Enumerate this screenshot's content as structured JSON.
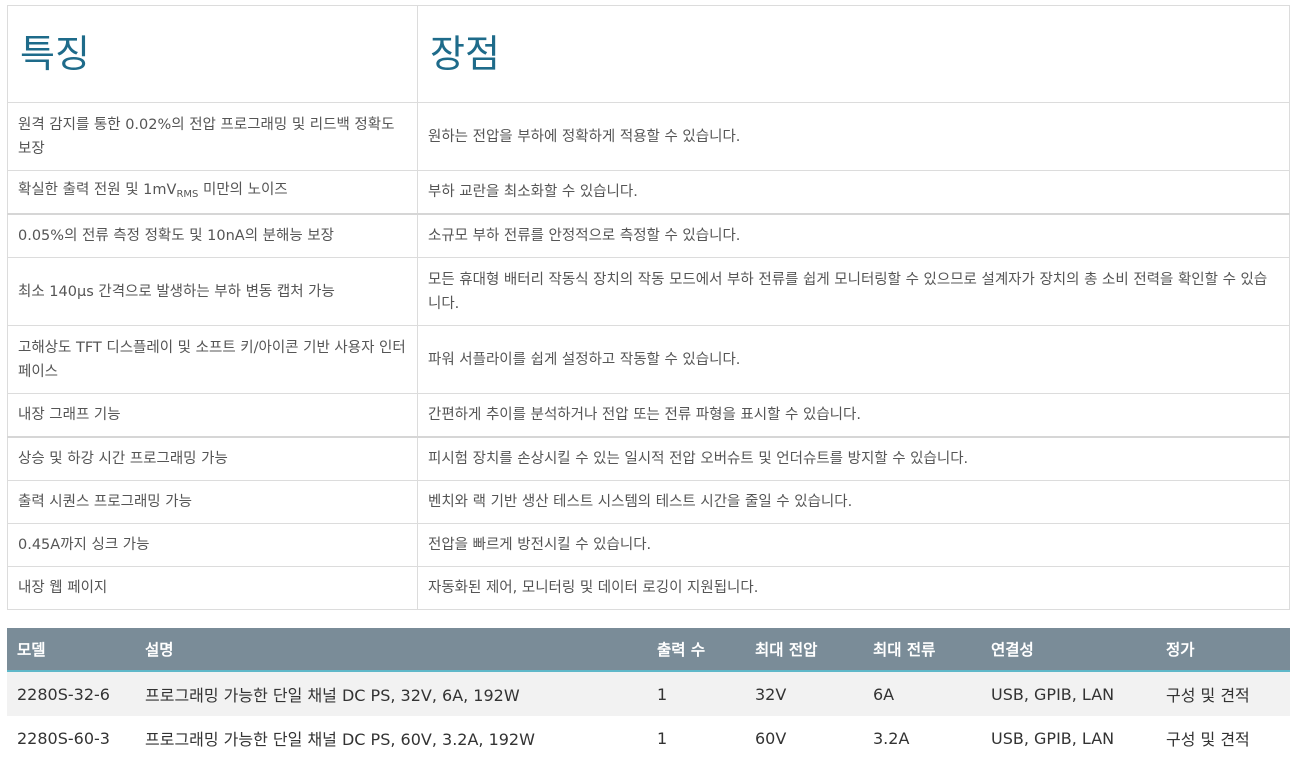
{
  "features": {
    "header_feature": "특징",
    "header_benefit": "장점",
    "rows": [
      {
        "feature": "원격 감지를 통한 0.02%의 전압 프로그래밍 및 리드백 정확도 보장",
        "benefit": "원하는 전압을 부하에 정확하게 적용할 수 있습니다."
      },
      {
        "feature_pre": "확실한 출력 전원 및 1mV",
        "feature_sub": "RMS",
        "feature_post": " 미만의 노이즈",
        "benefit": "부하 교란을 최소화할 수 있습니다."
      },
      {
        "feature": "0.05%의 전류 측정 정확도 및 10nA의 분해능 보장",
        "benefit": "소규모 부하 전류를 안정적으로 측정할 수 있습니다."
      },
      {
        "feature": "최소 140μs 간격으로 발생하는 부하 변동 캡처 가능",
        "benefit": "모든 휴대형 배터리 작동식 장치의 작동 모드에서 부하 전류를 쉽게 모니터링할 수 있으므로 설계자가 장치의 총 소비 전력을 확인할 수 있습니다."
      },
      {
        "feature": "고해상도 TFT 디스플레이 및 소프트 키/아이콘 기반 사용자 인터페이스",
        "benefit": "파워 서플라이를 쉽게 설정하고 작동할 수 있습니다."
      },
      {
        "feature": "내장 그래프 기능",
        "benefit": "간편하게 추이를 분석하거나 전압 또는 전류 파형을 표시할 수 있습니다."
      },
      {
        "feature": "상승 및 하강 시간 프로그래밍 가능",
        "benefit": "피시험 장치를 손상시킬 수 있는 일시적 전압 오버슈트 및 언더슈트를 방지할 수 있습니다."
      },
      {
        "feature": "출력 시퀀스 프로그래밍 가능",
        "benefit": "벤치와 랙 기반 생산 테스트 시스템의 테스트 시간을 줄일 수 있습니다."
      },
      {
        "feature": "0.45A까지 싱크 가능",
        "benefit": "전압을 빠르게 방전시킬 수 있습니다."
      },
      {
        "feature": "내장 웹 페이지",
        "benefit": "자동화된 제어, 모니터링 및 데이터 로깅이 지원됩니다."
      }
    ]
  },
  "products": {
    "headers": [
      "모델",
      "설명",
      "출력 수",
      "최대 전압",
      "최대 전류",
      "연결성",
      "정가"
    ],
    "rows": [
      {
        "model": "2280S-32-6",
        "description": "프로그래밍 가능한 단일 채널 DC PS, 32V, 6A, 192W",
        "outputs": "1",
        "max_voltage": "32V",
        "max_current": "6A",
        "connectivity": "USB, GPIB, LAN",
        "price_link": "구성 및 견적"
      },
      {
        "model": "2280S-60-3",
        "description": "프로그래밍 가능한 단일 채널 DC PS, 60V, 3.2A, 192W",
        "outputs": "1",
        "max_voltage": "60V",
        "max_current": "3.2A",
        "connectivity": "USB, GPIB, LAN",
        "price_link": "구성 및 견적"
      }
    ]
  },
  "colors": {
    "heading": "#1e6b8a",
    "table_header_bg": "#7a8c98",
    "link": "#2a9bb8",
    "header_accent": "#5fb8c9"
  }
}
